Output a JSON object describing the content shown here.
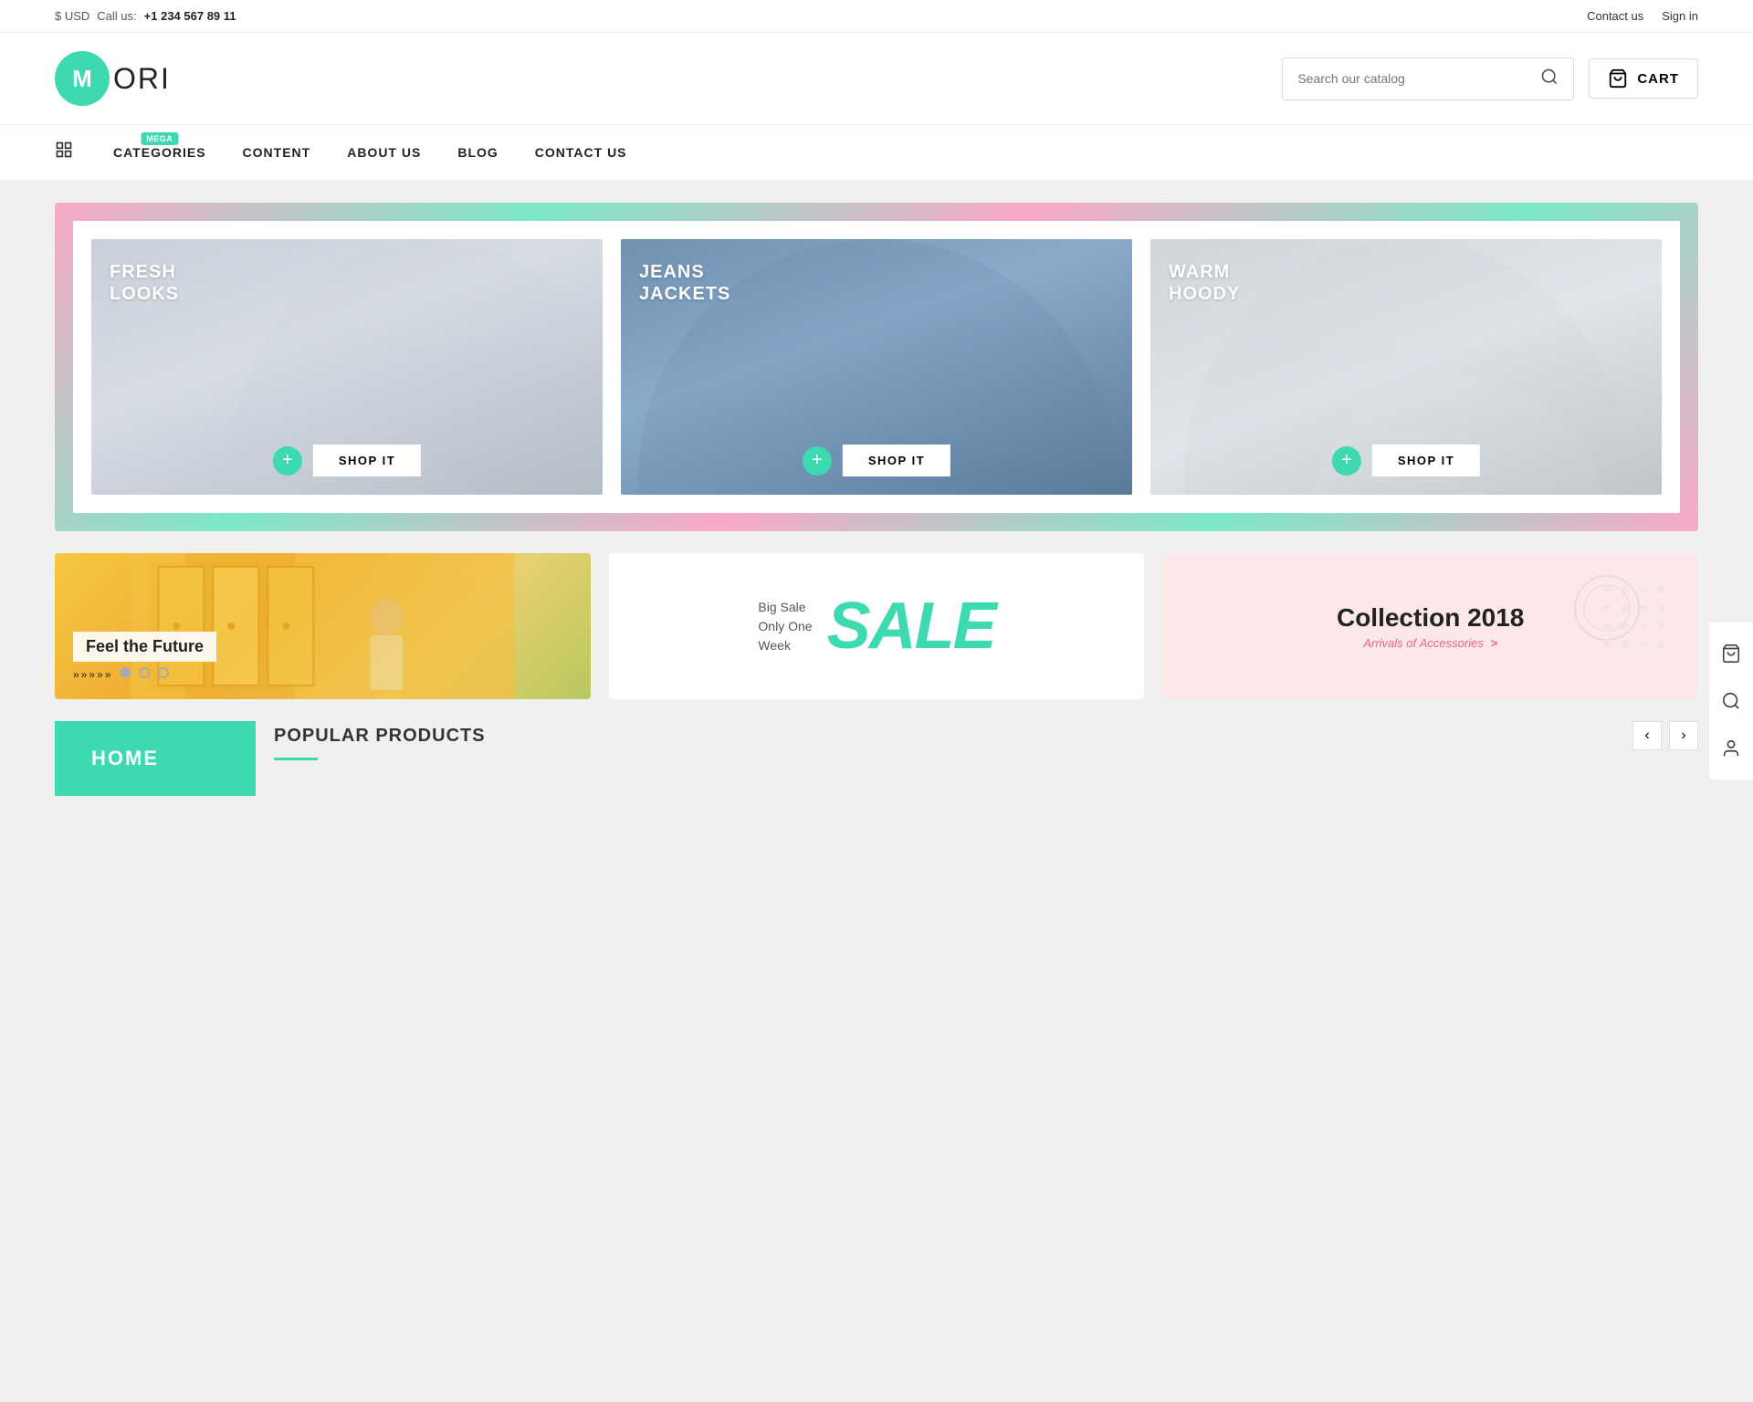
{
  "topbar": {
    "currency": "$ USD",
    "call_label": "Call us:",
    "phone": "+1 234 567 89 11",
    "contact_link": "Contact us",
    "signin_link": "Sign in"
  },
  "header": {
    "logo_letter": "M",
    "logo_text": "ORI",
    "search_placeholder": "Search our catalog",
    "cart_label": "CART"
  },
  "nav": {
    "mega_badge": "Mega",
    "items": [
      {
        "label": "CATEGORIES"
      },
      {
        "label": "CONTENT"
      },
      {
        "label": "ABOUT US"
      },
      {
        "label": "BLOG"
      },
      {
        "label": "CONTACT US"
      }
    ]
  },
  "hero": {
    "cards": [
      {
        "label_line1": "FRESH",
        "label_line2": "LOOKS",
        "shop_label": "SHOP IT"
      },
      {
        "label_line1": "JEANS",
        "label_line2": "JACKETS",
        "shop_label": "SHOP IT"
      },
      {
        "label_line1": "WARM",
        "label_line2": "HOODY",
        "shop_label": "SHOP IT"
      }
    ]
  },
  "promos": {
    "feel": {
      "title": "Feel the Future",
      "arrows": "»»»»»"
    },
    "sale": {
      "pre_text_line1": "Big Sale",
      "pre_text_line2": "Only One",
      "pre_text_line3": "Week",
      "sale_word": "SALE"
    },
    "collection": {
      "title": "Collection 2018",
      "subtitle": "Arrivals of",
      "highlighted": "Accessories",
      "link_symbol": ">"
    }
  },
  "bottom": {
    "home_tab": "HOME",
    "popular_title": "POPULAR PRODUCTS"
  },
  "float_toolbar": {
    "cart_icon": "🛍",
    "search_icon": "🔍",
    "user_icon": "👤"
  }
}
